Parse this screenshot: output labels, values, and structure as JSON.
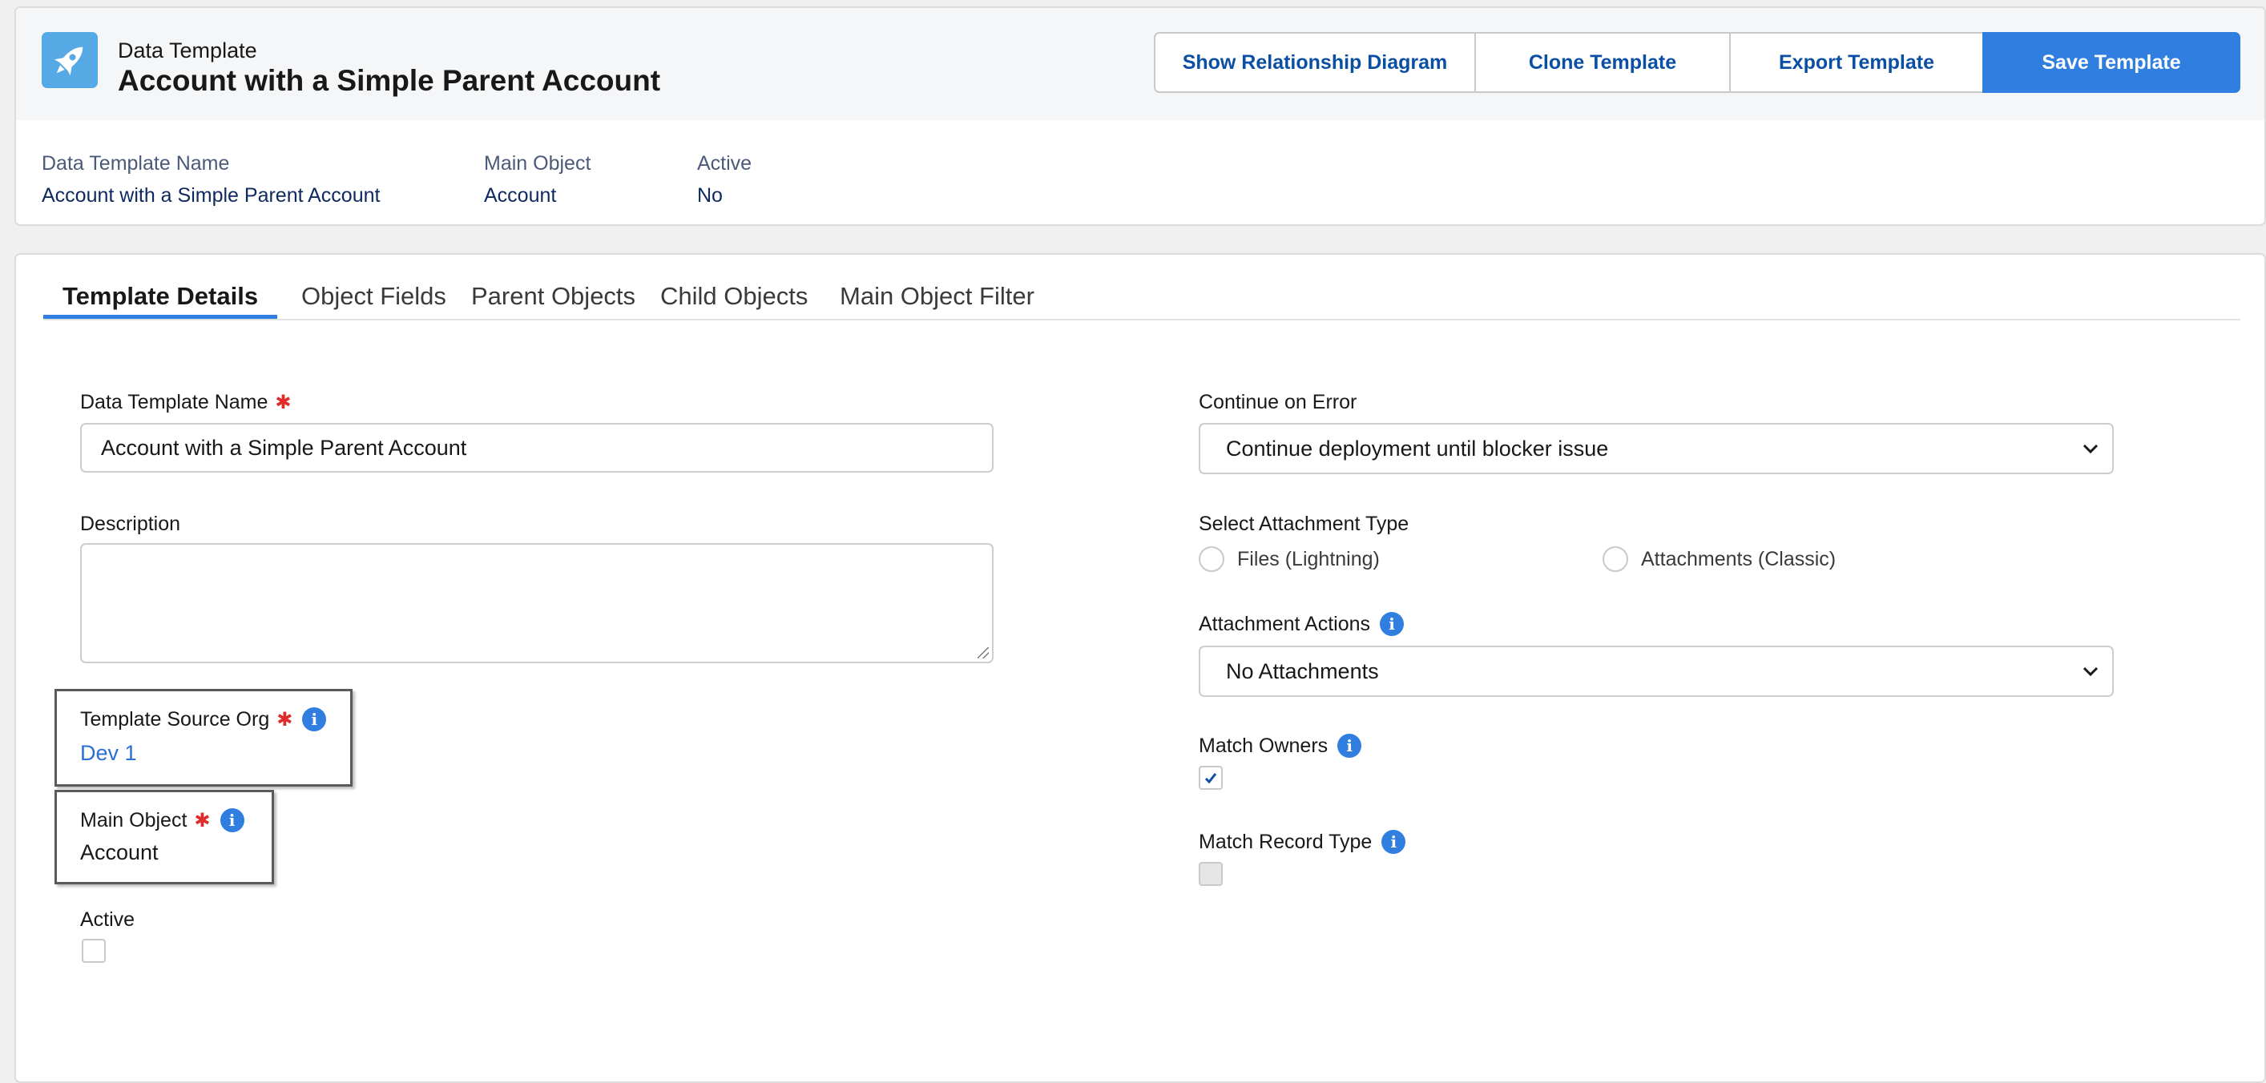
{
  "header": {
    "icon": "rocket-icon",
    "subtitle": "Data Template",
    "title": "Account with a Simple Parent Account",
    "buttons": {
      "diagram": "Show Relationship Diagram",
      "clone": "Clone Template",
      "export": "Export Template",
      "save": "Save Template"
    },
    "fields": [
      {
        "label": "Data Template Name",
        "value": "Account with a Simple Parent Account"
      },
      {
        "label": "Main Object",
        "value": "Account"
      },
      {
        "label": "Active",
        "value": "No"
      }
    ]
  },
  "tabs": [
    "Template Details",
    "Object Fields",
    "Parent Objects",
    "Child Objects",
    "Main Object Filter"
  ],
  "active_tab": "Template Details",
  "form": {
    "name": {
      "label": "Data Template Name",
      "value": "Account with a Simple Parent Account"
    },
    "description": {
      "label": "Description",
      "value": ""
    },
    "source_org": {
      "label": "Template Source Org",
      "value": "Dev 1"
    },
    "main_object": {
      "label": "Main Object",
      "value": "Account"
    },
    "active": {
      "label": "Active",
      "checked": false
    },
    "continue_on_error": {
      "label": "Continue on Error",
      "value": "Continue deployment until blocker issue"
    },
    "attachment_type": {
      "label": "Select Attachment Type",
      "options": [
        "Files (Lightning)",
        "Attachments (Classic)"
      ]
    },
    "attachment_actions": {
      "label": "Attachment Actions",
      "value": "No Attachments"
    },
    "match_owners": {
      "label": "Match Owners",
      "checked": true
    },
    "match_record_type": {
      "label": "Match Record Type",
      "checked": false,
      "disabled": true
    }
  },
  "colors": {
    "accent": "#2f7ee0",
    "link": "#2a6fd6",
    "required": "#e02b2b"
  }
}
